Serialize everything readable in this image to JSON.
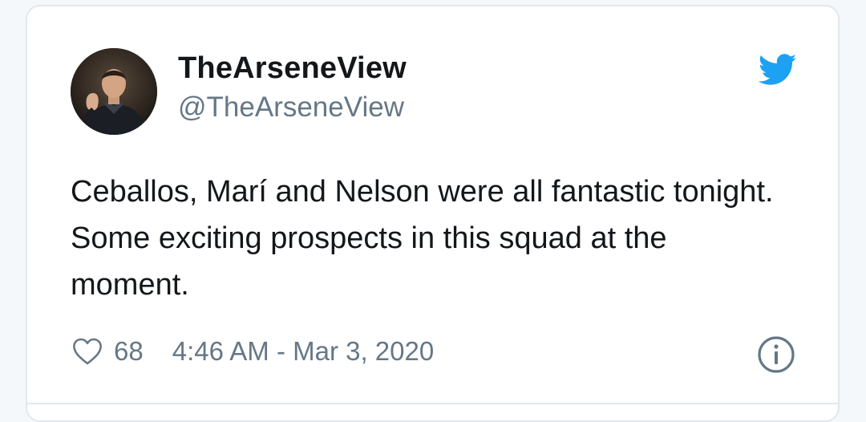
{
  "tweet": {
    "display_name": "TheArseneView",
    "handle": "@TheArseneView",
    "text": "Ceballos, Marí and Nelson were all fantastic tonight. Some exciting prospects in this squad at the moment.",
    "likes": "68",
    "timestamp": "4:46 AM - Mar 3, 2020"
  },
  "icons": {
    "brand": "twitter-bird-icon",
    "like": "heart-icon",
    "info": "info-icon"
  },
  "colors": {
    "brand_blue": "#1da1f2",
    "text_primary": "#14171a",
    "text_secondary": "#657786",
    "border": "#e1e8ed"
  }
}
